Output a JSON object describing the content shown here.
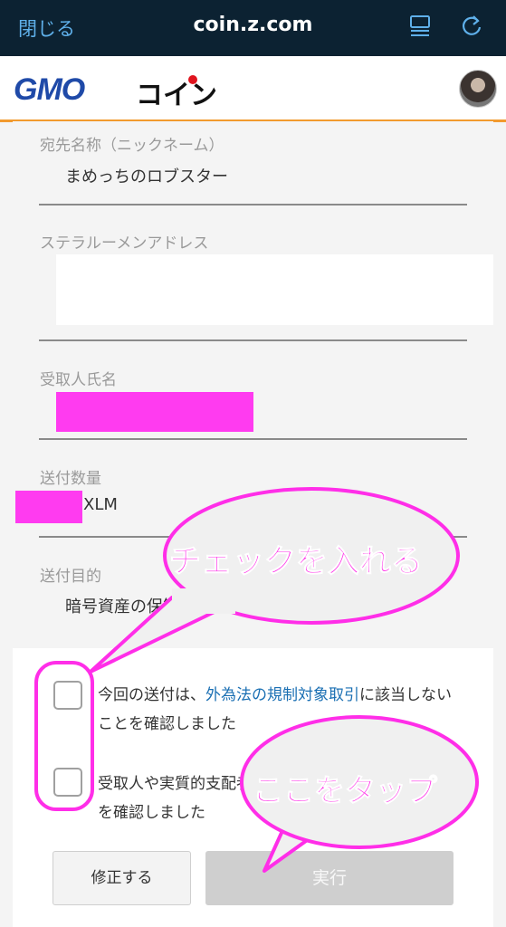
{
  "browser": {
    "close_label": "閉じる",
    "url": "coin.z.com"
  },
  "header": {
    "logo_gmo": "GMO",
    "logo_coin": "コイン"
  },
  "form": {
    "recipient_label": "宛先名称（ニックネーム）",
    "recipient_value": "まめっちのロブスター",
    "address_label": "ステラルーメンアドレス",
    "receiver_name_label": "受取人氏名",
    "amount_label": "送付数量",
    "amount_unit": "XLM",
    "purpose_label": "送付目的",
    "purpose_value": "暗号資産の保管"
  },
  "checks": [
    {
      "text_before": "今回の送付は、",
      "link": "外為法の規制対象取引",
      "text_after": "に該当しないことを確認しました"
    },
    {
      "text_before": "受取人や実質的支配者が反社会的勢力では",
      "link": "",
      "text_after": "ないことを確認しました"
    }
  ],
  "buttons": {
    "fix": "修正する",
    "run": "実行"
  },
  "annotations": {
    "top_bubble": "チェックを入れる",
    "bottom_bubble": "ここをタップ"
  }
}
